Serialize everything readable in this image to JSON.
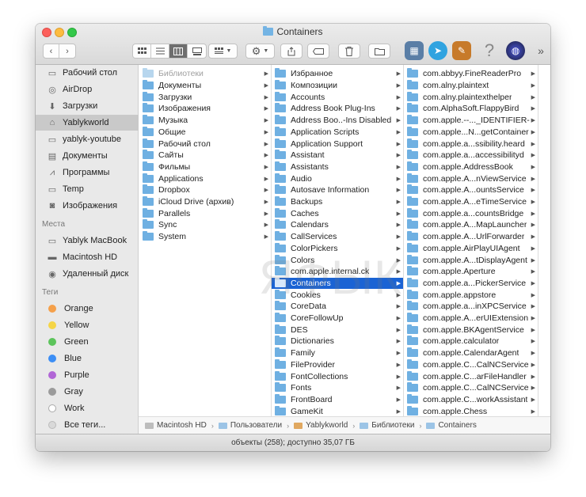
{
  "window": {
    "title": "Containers"
  },
  "toolbar": {
    "back": "‹",
    "forward": "›",
    "more": "»"
  },
  "sidebar": {
    "favorites": [
      {
        "label": "Рабочий стол",
        "icon": "desktop-icon"
      },
      {
        "label": "AirDrop",
        "icon": "airdrop-icon"
      },
      {
        "label": "Загрузки",
        "icon": "downloads-icon"
      },
      {
        "label": "Yablykworld",
        "icon": "home-icon",
        "selected": true
      },
      {
        "label": "yablyk-youtube",
        "icon": "folder-icon"
      },
      {
        "label": "Документы",
        "icon": "documents-icon"
      },
      {
        "label": "Программы",
        "icon": "applications-icon"
      },
      {
        "label": "Temp",
        "icon": "folder-icon"
      },
      {
        "label": "Изображения",
        "icon": "camera-icon"
      }
    ],
    "places_header": "Места",
    "places": [
      {
        "label": "Yablyk MacBook",
        "icon": "laptop-icon"
      },
      {
        "label": "Macintosh HD",
        "icon": "drive-icon"
      },
      {
        "label": "Удаленный диск",
        "icon": "disc-icon"
      }
    ],
    "tags_header": "Теги",
    "tags": [
      {
        "label": "Orange",
        "color": "#f5a04a"
      },
      {
        "label": "Yellow",
        "color": "#f5d547"
      },
      {
        "label": "Green",
        "color": "#5cc45b"
      },
      {
        "label": "Blue",
        "color": "#3c8ef5"
      },
      {
        "label": "Purple",
        "color": "#b166d6"
      },
      {
        "label": "Gray",
        "color": "#9b9b9b"
      },
      {
        "label": "Work",
        "color": "#ffffff"
      },
      {
        "label": "Все теги...",
        "color": "#d9d9d9"
      }
    ]
  },
  "columns": {
    "col1": [
      {
        "label": "Библиотеки",
        "dim": true
      },
      {
        "label": "Документы"
      },
      {
        "label": "Загрузки"
      },
      {
        "label": "Изображения"
      },
      {
        "label": "Музыка"
      },
      {
        "label": "Общие"
      },
      {
        "label": "Рабочий стол"
      },
      {
        "label": "Сайты"
      },
      {
        "label": "Фильмы"
      },
      {
        "label": "Applications"
      },
      {
        "label": "Dropbox"
      },
      {
        "label": "iCloud Drive (архив)"
      },
      {
        "label": "Parallels"
      },
      {
        "label": "Sync"
      },
      {
        "label": "System"
      }
    ],
    "col2": [
      {
        "label": "Избранное"
      },
      {
        "label": "Композиции"
      },
      {
        "label": "Accounts"
      },
      {
        "label": "Address Book Plug-Ins"
      },
      {
        "label": "Address Boo..-Ins Disabled"
      },
      {
        "label": "Application Scripts"
      },
      {
        "label": "Application Support"
      },
      {
        "label": "Assistant"
      },
      {
        "label": "Assistants"
      },
      {
        "label": "Audio"
      },
      {
        "label": "Autosave Information"
      },
      {
        "label": "Backups"
      },
      {
        "label": "Caches"
      },
      {
        "label": "Calendars"
      },
      {
        "label": "CallServices"
      },
      {
        "label": "ColorPickers"
      },
      {
        "label": "Colors"
      },
      {
        "label": "com.apple.internal.ck"
      },
      {
        "label": "Containers",
        "selected": true
      },
      {
        "label": "Cookies"
      },
      {
        "label": "CoreData"
      },
      {
        "label": "CoreFollowUp"
      },
      {
        "label": "DES"
      },
      {
        "label": "Dictionaries"
      },
      {
        "label": "Family"
      },
      {
        "label": "FileProvider"
      },
      {
        "label": "FontCollections"
      },
      {
        "label": "Fonts"
      },
      {
        "label": "FrontBoard"
      },
      {
        "label": "GameKit"
      }
    ],
    "col3": [
      {
        "label": "com.abbyy.FineReaderPro"
      },
      {
        "label": "com.alny.plaintext"
      },
      {
        "label": "com.alny.plaintexthelper"
      },
      {
        "label": "com.AlphaSoft.FlappyBird"
      },
      {
        "label": "com.apple.--..._IDENTIFIER-"
      },
      {
        "label": "com.apple...N...getContainer"
      },
      {
        "label": "com.apple.a...ssibility.heard"
      },
      {
        "label": "com.apple.a...accessibilityd"
      },
      {
        "label": "com.apple.AddressBook"
      },
      {
        "label": "com.apple.A...nViewService"
      },
      {
        "label": "com.apple.A...ountsService"
      },
      {
        "label": "com.apple.A...eTimeService"
      },
      {
        "label": "com.apple.a...countsBridge"
      },
      {
        "label": "com.apple.A...MapLauncher"
      },
      {
        "label": "com.apple.A...UrlForwarder"
      },
      {
        "label": "com.apple.AirPlayUIAgent"
      },
      {
        "label": "com.apple.A...tDisplayAgent"
      },
      {
        "label": "com.apple.Aperture"
      },
      {
        "label": "com.apple.a...PickerService"
      },
      {
        "label": "com.apple.appstore"
      },
      {
        "label": "com.apple.a...inXPCService"
      },
      {
        "label": "com.apple.A...erUIExtension"
      },
      {
        "label": "com.apple.BKAgentService"
      },
      {
        "label": "com.apple.calculator"
      },
      {
        "label": "com.apple.CalendarAgent"
      },
      {
        "label": "com.apple.C...CalNCService"
      },
      {
        "label": "com.apple.C...arFileHandler"
      },
      {
        "label": "com.apple.C...CalNCService"
      },
      {
        "label": "com.apple.C...workAssistant"
      },
      {
        "label": "com.apple.Chess"
      }
    ]
  },
  "pathbar": [
    {
      "label": "Macintosh HD"
    },
    {
      "label": "Пользователи"
    },
    {
      "label": "Yablykworld"
    },
    {
      "label": "Библиотеки"
    },
    {
      "label": "Containers"
    }
  ],
  "status": "объекты (258); доступно 35,07 ГБ",
  "watermark": "ЯФЫК"
}
